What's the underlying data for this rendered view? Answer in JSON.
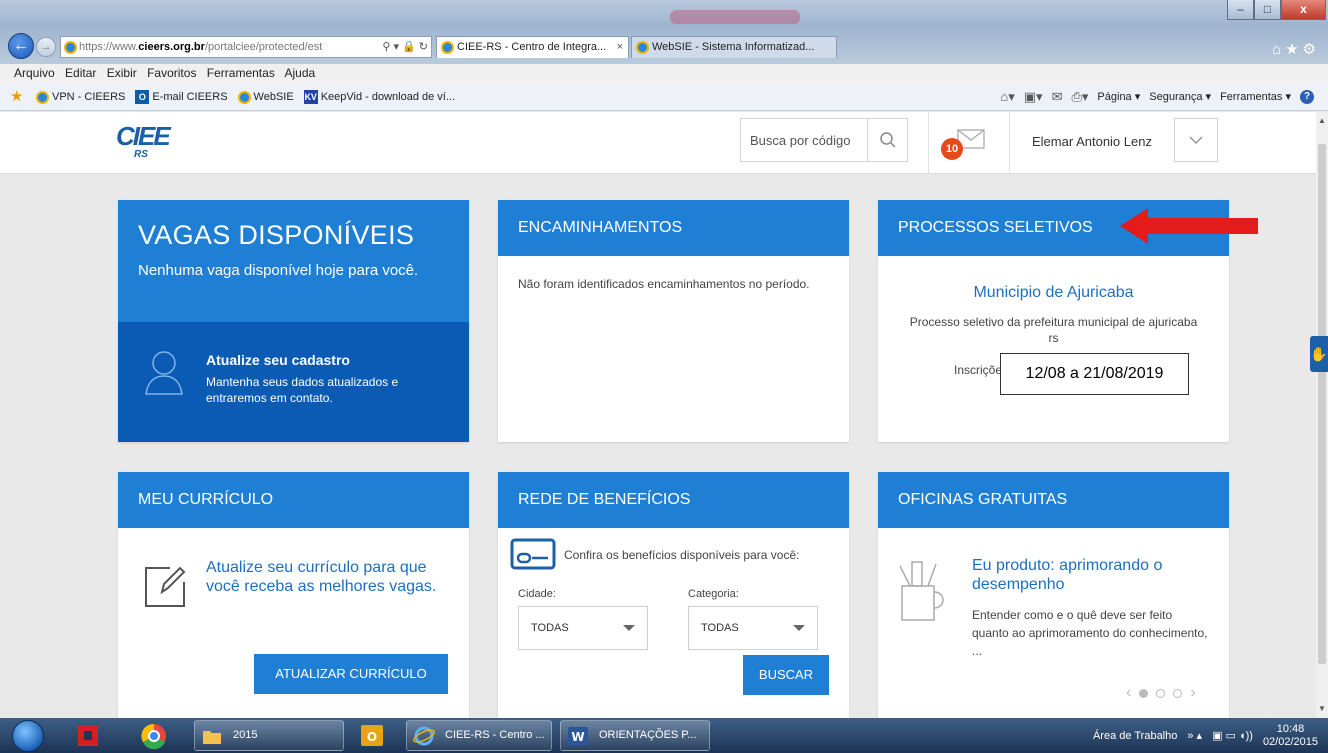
{
  "browser": {
    "address": {
      "scheme": "https://www.",
      "host": "cieers.org.br",
      "path": "/portalciee/protected/est"
    },
    "tabs": [
      {
        "label": "CIEE-RS - Centro de Integra..."
      },
      {
        "label": "WebSIE - Sistema Informatizad..."
      }
    ],
    "menu": [
      "Arquivo",
      "Editar",
      "Exibir",
      "Favoritos",
      "Ferramentas",
      "Ajuda"
    ],
    "favorites": [
      "VPN - CIEERS",
      "E-mail CIEERS",
      "WebSIE",
      "KeepVid - download de ví..."
    ],
    "commands": {
      "page": "Página ▾",
      "security": "Segurança ▾",
      "tools": "Ferramentas ▾"
    },
    "window_buttons": {
      "minimize": "–",
      "maximize": "□",
      "close": "x"
    }
  },
  "header": {
    "logo_text": "CIEE",
    "logo_sub": "RS",
    "search_placeholder": "Busca por código",
    "mail_count": "10",
    "user_name": "Elemar Antonio Lenz"
  },
  "cards": {
    "vagas": {
      "title": "VAGAS DISPONÍVEIS",
      "subtitle": "Nenhuma vaga disponível hoje para você.",
      "update_title": "Atualize seu cadastro",
      "update_text": "Mantenha seus dados atualizados e entraremos em contato."
    },
    "encaminhamentos": {
      "title": "ENCAMINHAMENTOS",
      "message": "Não foram identificados encaminhamentos no período."
    },
    "processos": {
      "title": "PROCESSOS SELETIVOS",
      "item_title": "Municipio de Ajuricaba",
      "item_desc": "Processo seletivo da prefeitura municipal de ajuricaba rs",
      "inscricoes_label": "Inscrições:",
      "inscricoes_dates": "12/08 a 21/08/2019"
    },
    "curriculo": {
      "title": "MEU CURRÍCULO",
      "text": "Atualize seu currículo para que você receba as melhores vagas.",
      "button": "ATUALIZAR CURRÍCULO"
    },
    "rede": {
      "title": "REDE DE BENEFÍCIOS",
      "text": "Confira os benefícios disponíveis para você:",
      "city_label": "Cidade:",
      "city_value": "TODAS",
      "category_label": "Categoria:",
      "category_value": "TODAS",
      "button": "BUSCAR"
    },
    "oficinas": {
      "title": "OFICINAS GRATUITAS",
      "item_title": "Eu produto: aprimorando o desempenho",
      "item_desc": "Entender como e o quê deve ser feito quanto ao aprimoramento do conhecimento, ..."
    }
  },
  "taskbar": {
    "items": [
      {
        "label": "2015"
      },
      {
        "label": "CIEE-RS - Centro ..."
      },
      {
        "label": "ORIENTAÇÕES P..."
      }
    ],
    "desktop_label": "Área de Trabalho",
    "time": "10:48",
    "date": "02/02/2015"
  },
  "colors": {
    "primary_blue": "#1e7fd4",
    "dark_blue": "#0b5bb5",
    "badge_orange": "#e64a19",
    "arrow_red": "#e31b1b"
  }
}
